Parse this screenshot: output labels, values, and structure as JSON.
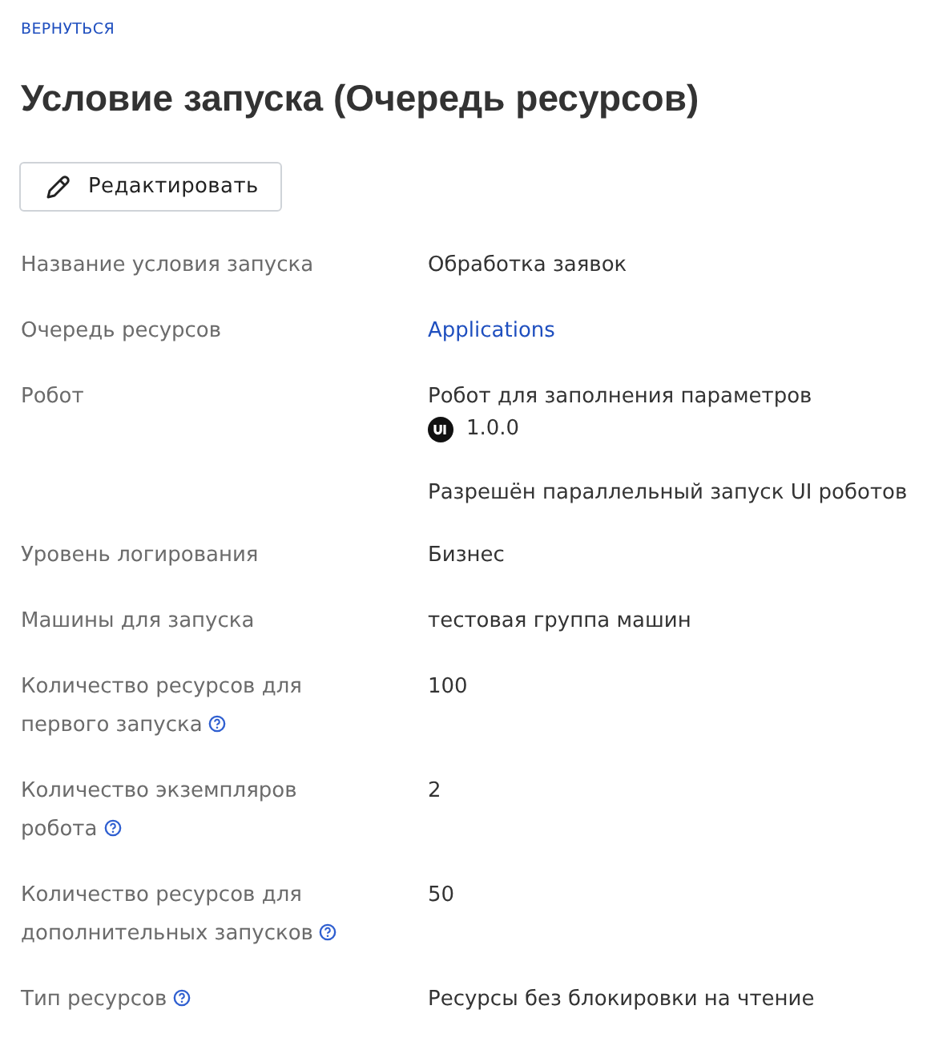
{
  "back_link": "ВЕРНУТЬСЯ",
  "title": "Условие запуска (Очередь ресурсов)",
  "edit_button": "Редактировать",
  "details": [
    {
      "label": "Название условия запуска",
      "help": false,
      "kind": "text",
      "value": "Обработка заявок"
    },
    {
      "label": "Очередь ресурсов",
      "help": false,
      "kind": "link",
      "value": "Applications"
    },
    {
      "label": "Робот",
      "help": false,
      "kind": "robot",
      "value": "Робот для заполнения параметров",
      "version": "1.0.0",
      "note": "Разрешён параллельный запуск UI роботов"
    },
    {
      "label": "Уровень логирования",
      "help": false,
      "kind": "text",
      "value": "Бизнес"
    },
    {
      "label": "Машины для запуска",
      "help": false,
      "kind": "text",
      "value": "тестовая группа машин"
    },
    {
      "label": "Количество ресурсов для первого запуска",
      "help": true,
      "kind": "text",
      "value": "100"
    },
    {
      "label": "Количество экземпляров робота",
      "help": true,
      "kind": "text",
      "value": "2"
    },
    {
      "label": "Количество ресурсов для дополнительных запусков",
      "help": true,
      "kind": "text",
      "value": "50"
    },
    {
      "label": "Тип ресурсов",
      "help": true,
      "kind": "text",
      "value": "Ресурсы без блокировки на чтение"
    }
  ]
}
